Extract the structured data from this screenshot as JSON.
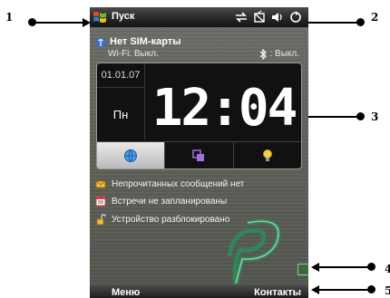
{
  "callouts": [
    "1",
    "2",
    "3",
    "4",
    "5"
  ],
  "titlebar": {
    "start_label": "Пуск",
    "tray_icons": [
      "sync-icon",
      "no-signal-icon",
      "volume-icon",
      "connection-icon"
    ]
  },
  "status": {
    "sim": "Нет SIM-карты",
    "wifi": "Wi-Fi: Выкл.",
    "bluetooth": ": Выкл."
  },
  "clock_widget": {
    "date": "01.01.07",
    "day": "Пн",
    "time": "12:04",
    "tabs": [
      "globe-icon",
      "windows-icon",
      "lightbulb-icon"
    ]
  },
  "today_items": [
    {
      "icon": "message-icon",
      "label": "Непрочитанных сообщений нет"
    },
    {
      "icon": "calendar-icon",
      "label": "Встречи не запланированы"
    },
    {
      "icon": "unlock-icon",
      "label": "Устройство разблокировано"
    }
  ],
  "softkeys": {
    "left": "Меню",
    "right": "Контакты"
  },
  "colors": {
    "background": "#5e625a",
    "bar": "#1e1e1e",
    "accent": "#2d8a5a"
  }
}
